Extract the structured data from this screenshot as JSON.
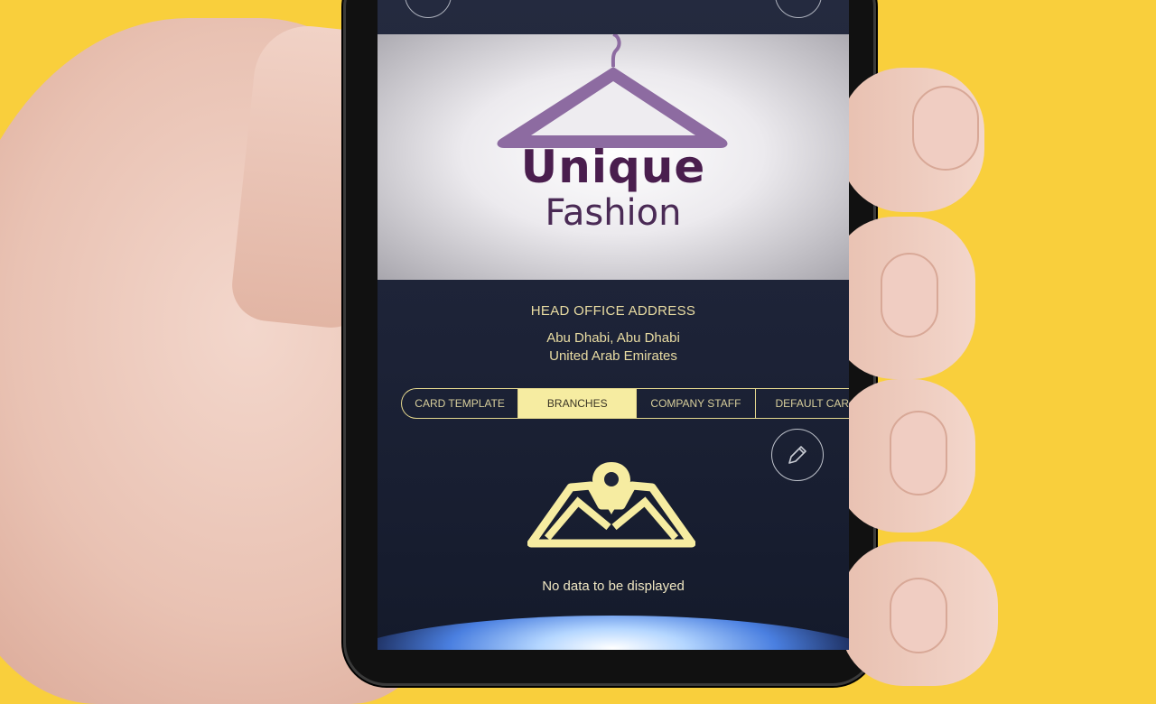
{
  "brand": {
    "name_line1": "Unique",
    "name_line2": "Fashion"
  },
  "address": {
    "title": "HEAD OFFICE ADDRESS",
    "line1": "Abu Dhabi, Abu Dhabi",
    "line2": "United Arab Emirates"
  },
  "tabs": [
    {
      "label": "CARD TEMPLATE",
      "active": false
    },
    {
      "label": "BRANCHES",
      "active": true
    },
    {
      "label": "COMPANY STAFF",
      "active": false
    },
    {
      "label": "DEFAULT CAR",
      "active": false
    }
  ],
  "empty_state": {
    "icon": "map-location-icon",
    "message": "No data to be displayed"
  },
  "actions": {
    "edit_icon": "pencil-icon"
  },
  "colors": {
    "background": "#f9cf3c",
    "accent": "#f6eca1",
    "text_gold": "#e9dca2",
    "brand_purple": "#4a1e4e"
  }
}
